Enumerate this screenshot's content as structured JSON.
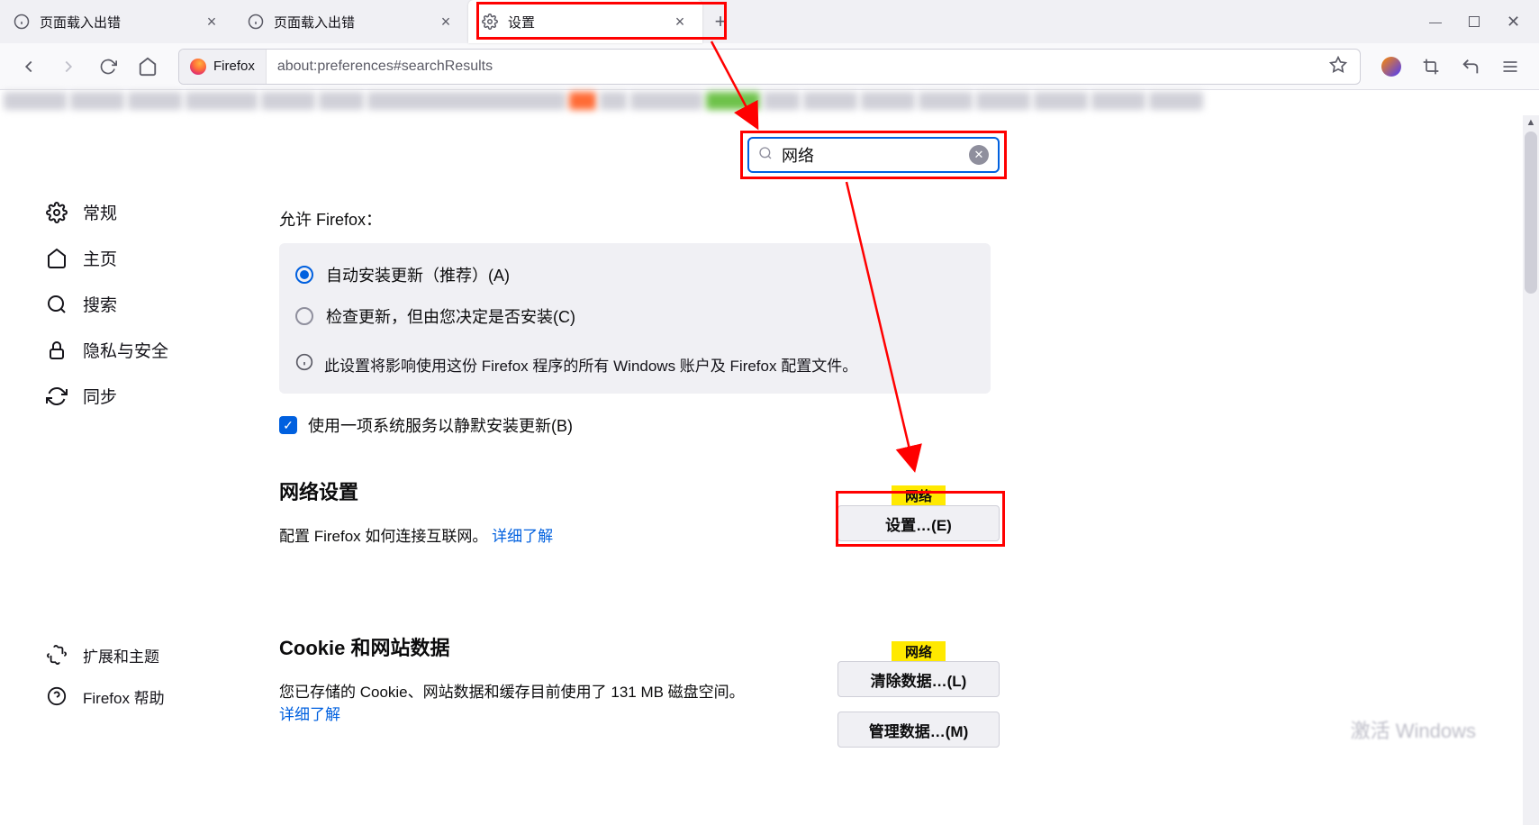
{
  "tabs": [
    {
      "label": "页面载入出错",
      "icon": "info"
    },
    {
      "label": "页面载入出错",
      "icon": "info"
    },
    {
      "label": "设置",
      "icon": "gear",
      "active": true
    }
  ],
  "url": {
    "identity": "Firefox",
    "value": "about:preferences#searchResults"
  },
  "search": {
    "value": "网络"
  },
  "sidebar": {
    "items": [
      {
        "label": "常规",
        "icon": "gear"
      },
      {
        "label": "主页",
        "icon": "home"
      },
      {
        "label": "搜索",
        "icon": "search"
      },
      {
        "label": "隐私与安全",
        "icon": "lock"
      },
      {
        "label": "同步",
        "icon": "sync"
      }
    ],
    "bottom": [
      {
        "label": "扩展和主题",
        "icon": "puzzle"
      },
      {
        "label": "Firefox 帮助",
        "icon": "help"
      }
    ]
  },
  "updates": {
    "allow_label": "允许 Firefox：",
    "opt_auto": "自动安装更新（推荐）(A)",
    "opt_check": "检查更新，但由您决定是否安装(C)",
    "info": "此设置将影响使用这份 Firefox 程序的所有 Windows 账户及 Firefox 配置文件。",
    "service": "使用一项系统服务以静默安装更新(B)"
  },
  "network": {
    "title": "网络设置",
    "desc": "配置 Firefox 如何连接互联网。",
    "link": "详细了解",
    "button": "设置…(E)",
    "tag": "网络"
  },
  "cookies": {
    "title": "Cookie 和网站数据",
    "desc": "您已存储的 Cookie、网站数据和缓存目前使用了 131 MB 磁盘空间。",
    "link": "详细了解",
    "clear": "清除数据…(L)",
    "manage": "管理数据…(M)",
    "tag": "网络"
  },
  "watermark": "激活 Windows"
}
